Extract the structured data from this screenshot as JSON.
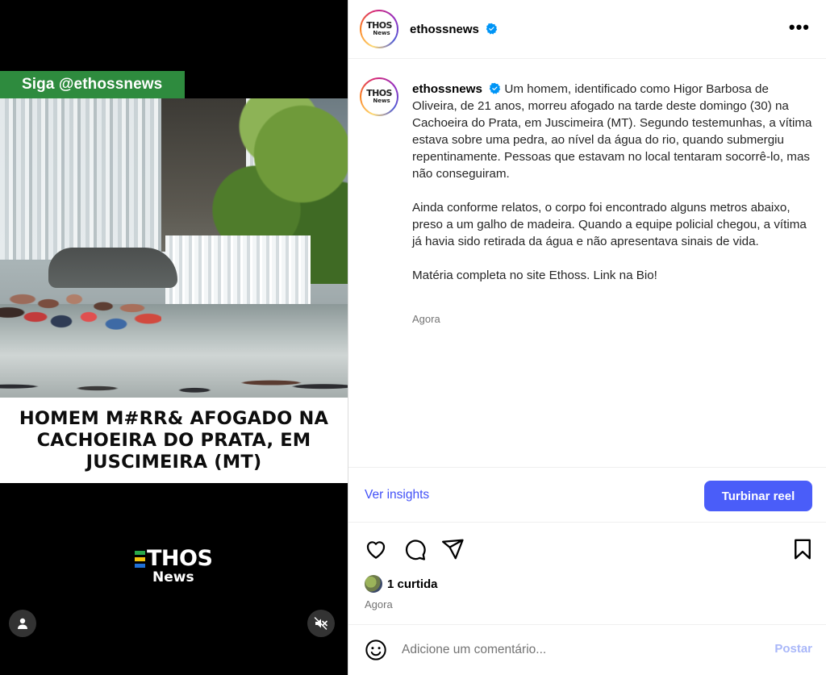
{
  "media": {
    "follow_tag": "Siga @ethossnews",
    "headline": "HOMEM M#RR& AFOGADO NA CACHOEIRA DO PRATA, EM JUSCIMEIRA (MT)",
    "logo_line1": "THOS",
    "logo_line2": "News",
    "user_tag_icon": "person-icon",
    "mute_icon": "speaker-muted-icon"
  },
  "header": {
    "avatar_line1": "THOS",
    "avatar_line2": "News",
    "username": "ethossnews",
    "more_label": "•••"
  },
  "caption": {
    "username": "ethossnews",
    "paragraph1": "Um homem, identificado como Higor Barbosa de Oliveira, de 21 anos, morreu afogado na tarde deste domingo (30) na Cachoeira do Prata, em Juscimeira (MT). Segundo testemunhas, a vítima estava sobre uma pedra, ao nível da água do rio, quando submergiu repentinamente. Pessoas que estavam no local tentaram socorrê-lo, mas não conseguiram.",
    "paragraph2": "Ainda conforme relatos, o corpo foi encontrado alguns metros abaixo, preso a um galho de madeira. Quando a equipe policial chegou, a vítima já havia sido retirada da água e não apresentava sinais de vida.",
    "paragraph3": "Matéria completa no site Ethoss. Link na Bio!",
    "time": "Agora"
  },
  "insights": {
    "view_label": "Ver insights",
    "boost_label": "Turbinar reel"
  },
  "actions": {
    "likes": "1 curtida",
    "time": "Agora"
  },
  "comment": {
    "placeholder": "Adicione um comentário...",
    "post_label": "Postar"
  },
  "colors": {
    "accent": "#4a5df9",
    "link": "#4150f7",
    "follow_tag_bg": "#2e8b3e",
    "verified": "#0095f6"
  }
}
